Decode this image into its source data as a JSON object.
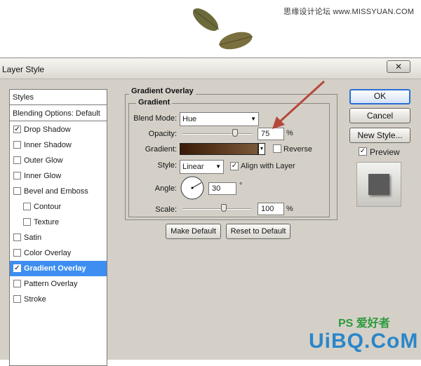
{
  "watermark": {
    "top_text": "思缘设计论坛 www.MISSYUAN.COM",
    "bottom_text": "UiBQ.CoM",
    "bottom_tag": "PS 爱好者"
  },
  "window": {
    "title": "Layer Style",
    "close_glyph": "✕"
  },
  "styles_list": {
    "header": "Styles",
    "blending": "Blending Options: Default",
    "items": [
      {
        "label": "Drop Shadow",
        "checked": true,
        "check_glyph": "✓",
        "indent": false,
        "selected": false
      },
      {
        "label": "Inner Shadow",
        "checked": false,
        "check_glyph": "",
        "indent": false,
        "selected": false
      },
      {
        "label": "Outer Glow",
        "checked": false,
        "check_glyph": "",
        "indent": false,
        "selected": false
      },
      {
        "label": "Inner Glow",
        "checked": false,
        "check_glyph": "",
        "indent": false,
        "selected": false
      },
      {
        "label": "Bevel and Emboss",
        "checked": false,
        "check_glyph": "",
        "indent": false,
        "selected": false
      },
      {
        "label": "Contour",
        "checked": false,
        "check_glyph": "",
        "indent": true,
        "selected": false
      },
      {
        "label": "Texture",
        "checked": false,
        "check_glyph": "",
        "indent": true,
        "selected": false
      },
      {
        "label": "Satin",
        "checked": false,
        "check_glyph": "",
        "indent": false,
        "selected": false
      },
      {
        "label": "Color Overlay",
        "checked": false,
        "check_glyph": "",
        "indent": false,
        "selected": false
      },
      {
        "label": "Gradient Overlay",
        "checked": true,
        "check_glyph": "✓",
        "indent": false,
        "selected": true
      },
      {
        "label": "Pattern Overlay",
        "checked": false,
        "check_glyph": "",
        "indent": false,
        "selected": false
      },
      {
        "label": "Stroke",
        "checked": false,
        "check_glyph": "",
        "indent": false,
        "selected": false
      }
    ]
  },
  "gradient_overlay": {
    "group_title": "Gradient Overlay",
    "subgroup_title": "Gradient",
    "blend_mode": {
      "label": "Blend Mode:",
      "value": "Hue",
      "arrow": "▼"
    },
    "opacity": {
      "label": "Opacity:",
      "value": "75",
      "unit": "%",
      "level": 0.75
    },
    "gradient": {
      "label": "Gradient:",
      "arrow": "▼",
      "reverse_label": "Reverse",
      "reverse_checked": false,
      "colors": [
        "#3a1a08",
        "#7a5838"
      ]
    },
    "style": {
      "label": "Style:",
      "value": "Linear",
      "arrow": "▼",
      "align_label": "Align with Layer",
      "align_checked": true,
      "check_glyph": "✓"
    },
    "angle": {
      "label": "Angle:",
      "value": "30",
      "unit": "°",
      "degrees": 30
    },
    "scale": {
      "label": "Scale:",
      "value": "100",
      "unit": "%",
      "level": 0.6
    },
    "make_default": "Make Default",
    "reset_default": "Reset to Default"
  },
  "right_panel": {
    "ok": "OK",
    "cancel": "Cancel",
    "new_style": "New Style...",
    "preview_label": "Preview",
    "preview_checked": true,
    "check_glyph": "✓"
  },
  "colors": {
    "accent": "#3d8ef0",
    "arrow": "#b5483a",
    "dialog_bg": "#d4d0c8"
  }
}
